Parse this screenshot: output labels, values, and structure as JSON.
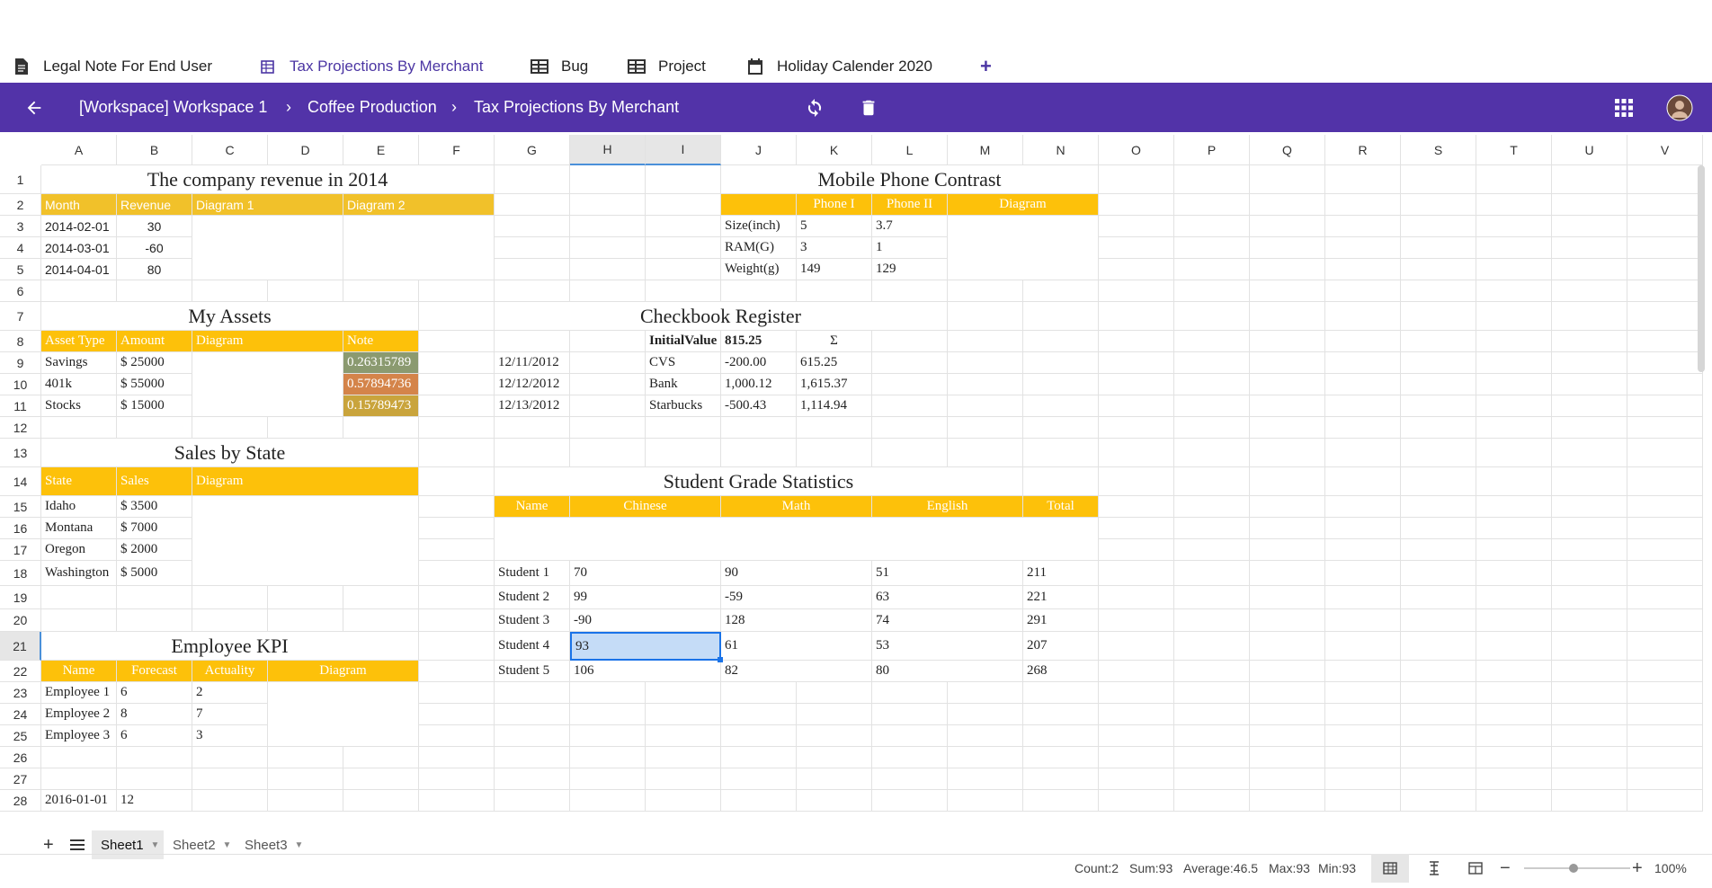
{
  "tabs": [
    {
      "label": "Legal Note For End User",
      "icon": "document-icon"
    },
    {
      "label": "Tax Projections By Merchant",
      "icon": "sheet-icon",
      "active": true
    },
    {
      "label": "Bug",
      "icon": "table-icon"
    },
    {
      "label": "Project",
      "icon": "table-icon"
    },
    {
      "label": "Holiday Calender 2020",
      "icon": "calendar-icon"
    }
  ],
  "breadcrumb": [
    "[Workspace] Workspace 1",
    "Coffee Production",
    "Tax Projections By Merchant"
  ],
  "breadcrumb_sep": "›",
  "columns": [
    "A",
    "B",
    "C",
    "D",
    "E",
    "F",
    "G",
    "H",
    "I",
    "J",
    "K",
    "L",
    "M",
    "N",
    "O",
    "P",
    "Q",
    "R",
    "S",
    "T",
    "U",
    "V"
  ],
  "rows": [
    "1",
    "2",
    "3",
    "4",
    "5",
    "6",
    "7",
    "8",
    "9",
    "10",
    "11",
    "12",
    "13",
    "14",
    "15",
    "16",
    "17",
    "18",
    "19",
    "20",
    "21",
    "22",
    "23",
    "24",
    "25",
    "26",
    "27",
    "28"
  ],
  "content": {
    "revenue_title": "The company revenue in 2014",
    "revenue_headers": [
      "Month",
      "Revenue",
      "Diagram 1",
      "Diagram 2"
    ],
    "revenue_months": [
      "2014-02-01",
      "2014-03-01",
      "2014-04-01"
    ],
    "revenue_values": [
      "30",
      "-60",
      "80"
    ],
    "phone_title": "Mobile Phone Contrast",
    "phone_headers": [
      "Phone I",
      "Phone II",
      "Diagram"
    ],
    "phone_rows": [
      [
        "Size(inch)",
        "5",
        "3.7"
      ],
      [
        "RAM(G)",
        "3",
        "1"
      ],
      [
        "Weight(g)",
        "149",
        "129"
      ]
    ],
    "assets_title": "My Assets",
    "assets_headers": [
      "Asset Type",
      "Amount",
      "Diagram",
      "Note"
    ],
    "assets_rows": [
      [
        "Savings",
        "$ 25000",
        "0.26315789"
      ],
      [
        "401k",
        "$ 55000",
        "0.57894736"
      ],
      [
        "Stocks",
        "$ 15000",
        "0.15789473"
      ]
    ],
    "check_title": "Checkbook Register",
    "check_header": [
      "InitialValue",
      "815.25",
      "Σ"
    ],
    "check_rows": [
      [
        "12/11/2012",
        "CVS",
        "-200.00",
        "615.25"
      ],
      [
        "12/12/2012",
        "Bank",
        "1,000.12",
        "1,615.37"
      ],
      [
        "12/13/2012",
        "Starbucks",
        "-500.43",
        "1,114.94"
      ]
    ],
    "sales_title": "Sales by State",
    "sales_headers": [
      "State",
      "Sales",
      "Diagram"
    ],
    "sales_rows": [
      [
        "Idaho",
        "$ 3500"
      ],
      [
        "Montana",
        "$ 7000"
      ],
      [
        "Oregon",
        "$ 2000"
      ],
      [
        "Washington",
        "$ 5000"
      ]
    ],
    "grade_title": "Student Grade Statistics",
    "grade_headers": [
      "Name",
      "Chinese",
      "Math",
      "English",
      "Total"
    ],
    "grade_rows": [
      [
        "Student 1",
        "70",
        "90",
        "51",
        "211"
      ],
      [
        "Student 2",
        "99",
        "-59",
        "63",
        "221"
      ],
      [
        "Student 3",
        "-90",
        "128",
        "74",
        "291"
      ],
      [
        "Student 4",
        "93",
        "61",
        "53",
        "207"
      ],
      [
        "Student 5",
        "106",
        "82",
        "80",
        "268"
      ]
    ],
    "kpi_title": "Employee KPI",
    "kpi_headers": [
      "Name",
      "Forecast",
      "Actuality",
      "Diagram"
    ],
    "kpi_rows": [
      [
        "Employee 1",
        "6",
        "2"
      ],
      [
        "Employee 2",
        "8",
        "7"
      ],
      [
        "Employee 3",
        "6",
        "3"
      ]
    ],
    "row28": [
      "2016-01-01",
      "12"
    ]
  },
  "sheets": [
    "Sheet1",
    "Sheet2",
    "Sheet3"
  ],
  "status": {
    "count": "Count:2",
    "sum": "Sum:93",
    "average": "Average:46.5",
    "max": "Max:93",
    "min": "Min:93",
    "zoom": "100%"
  },
  "colors": {
    "brand": "#5233a8",
    "header_fill": "#fdc10a",
    "selection": "#c5dcf7"
  }
}
